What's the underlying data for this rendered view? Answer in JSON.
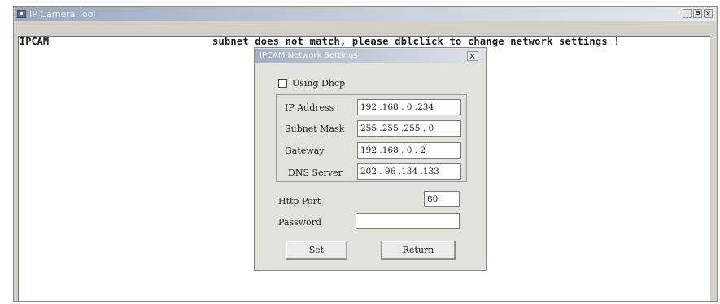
{
  "window": {
    "title": "IP Camera Tool"
  },
  "list": {
    "camera_name": "IPCAM",
    "status_message": "subnet does not match, please dblclick to change network settings !"
  },
  "dialog": {
    "title": "IPCAM Network Settings",
    "using_dhcp_label": "Using Dhcp",
    "using_dhcp_checked": false,
    "ip_address_label": "IP Address",
    "ip_address_value": "192 .168 . 0 .234",
    "subnet_mask_label": "Subnet Mask",
    "subnet_mask_value": "255 .255 .255 . 0",
    "gateway_label": "Gateway",
    "gateway_value": "192 .168 . 0 . 2",
    "dns_server_label": "DNS Server",
    "dns_server_value": "202 . 96 .134 .133",
    "http_port_label": "Http Port",
    "http_port_value": "80",
    "password_label": "Password",
    "password_value": "",
    "set_button": "Set",
    "return_button": "Return"
  }
}
